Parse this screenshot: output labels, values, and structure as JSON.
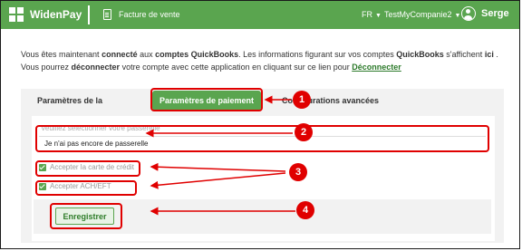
{
  "header": {
    "brand": "WidenPay",
    "page_title": "Facture de vente",
    "language": "FR",
    "company": "TestMyCompanie2",
    "user": "Serge"
  },
  "info": {
    "part1": "Vous êtes maintenant ",
    "bold1": "connecté",
    "part2": " aux ",
    "bold2": "comptes QuickBooks",
    "part3": ". Les informations figurant sur vos comptes ",
    "bold3": "QuickBooks",
    "part4": " s'affichent ",
    "bold4": "ici",
    "part5": " . Vous pourrez ",
    "bold5": "déconnecter",
    "part6": " votre compte avec cette application en cliquant sur ce lien pour ",
    "link": "Déconnecter"
  },
  "tabs": [
    {
      "label": "Paramètres de la compagnie"
    },
    {
      "label": "Paramètres de paiement"
    },
    {
      "label": "Configurations avancées"
    }
  ],
  "gateway": {
    "placeholder": "Veuillez sélectionner votre passerelle",
    "value": "Je n'ai pas encore de passerelle"
  },
  "options": {
    "credit_card": "Accepter la carte de crédit",
    "ach": "Accepter ACH/EFT"
  },
  "save_label": "Enregistrer",
  "annotations": [
    "1",
    "2",
    "3",
    "4"
  ],
  "colors": {
    "brand_green": "#5aa54f",
    "annotation_red": "#e00000"
  }
}
